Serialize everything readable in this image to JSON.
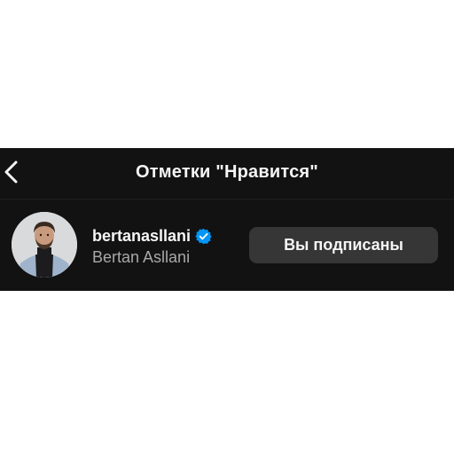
{
  "header": {
    "title": "Отметки \"Нравится\"",
    "back_icon": "chevron-left-icon"
  },
  "user": {
    "username": "bertanasllani",
    "full_name": "Bertan Asllani",
    "verified": true,
    "verified_icon": "verified-badge-icon",
    "follow_button_label": "Вы подписаны"
  },
  "colors": {
    "panel_background": "#121212",
    "primary_text": "#f5f5f5",
    "secondary_text": "#a8a8a8",
    "button_background": "#363636",
    "verified_blue": "#0095f6"
  }
}
